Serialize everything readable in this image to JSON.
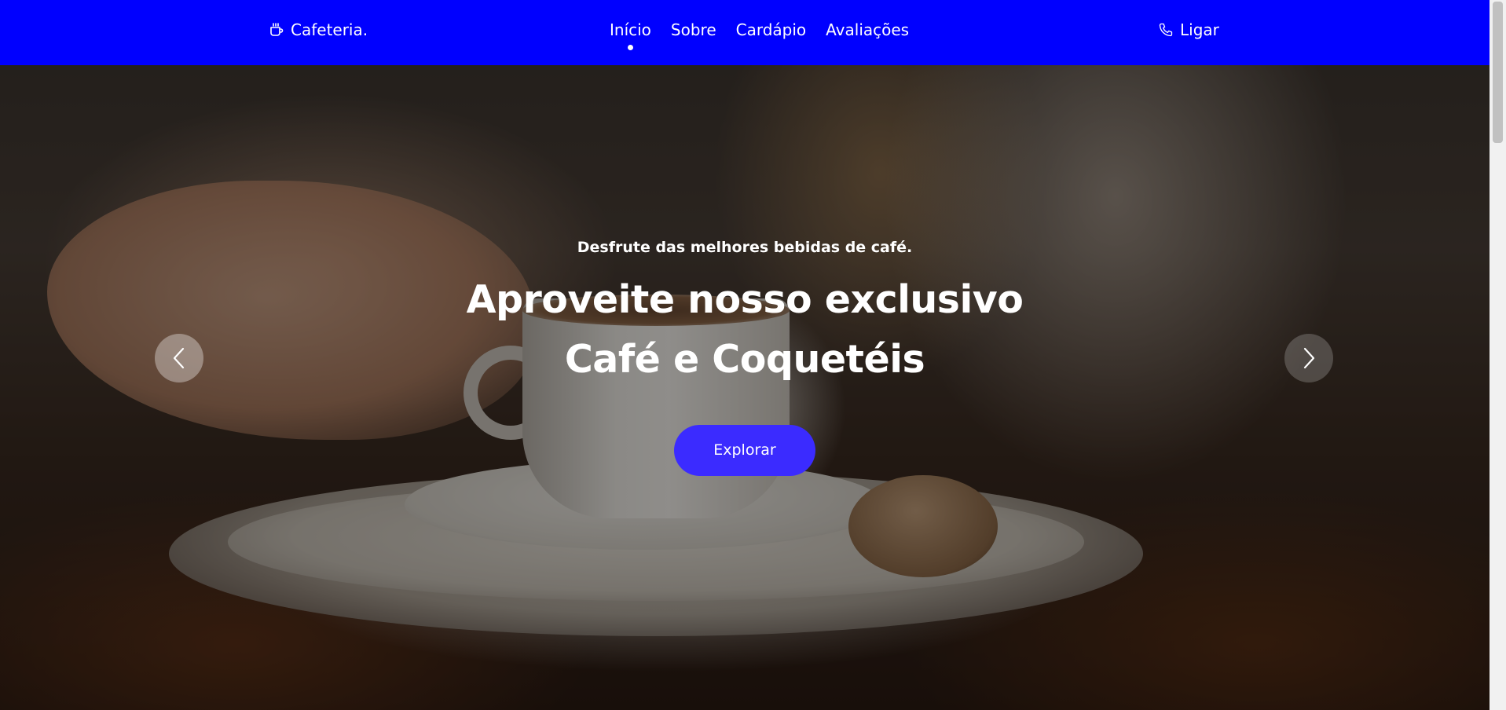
{
  "header": {
    "brand": "Cafeteria.",
    "brand_icon": "coffee-cup-icon",
    "nav": [
      {
        "label": "Início",
        "active": true
      },
      {
        "label": "Sobre",
        "active": false
      },
      {
        "label": "Cardápio",
        "active": false
      },
      {
        "label": "Avaliações",
        "active": false
      }
    ],
    "call_label": "Ligar",
    "call_icon": "phone-icon",
    "background_color": "#0000ff"
  },
  "hero": {
    "subtitle": "Desfrute das melhores bebidas de café.",
    "title_line1": "Aproveite nosso exclusivo",
    "title_line2": "Café e Coquetéis",
    "cta_label": "Explorar",
    "cta_color": "#3b2bff",
    "prev_icon": "chevron-left-icon",
    "next_icon": "chevron-right-icon"
  }
}
